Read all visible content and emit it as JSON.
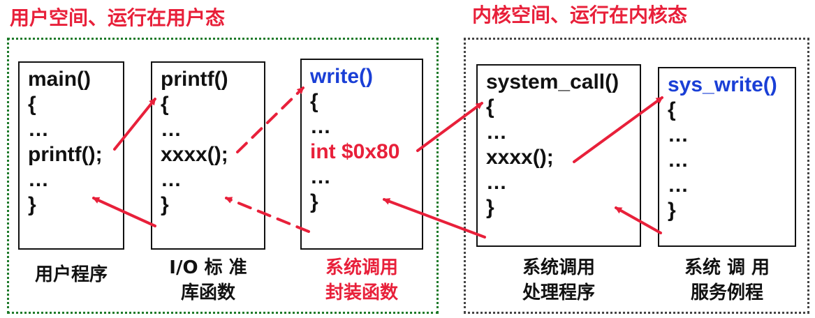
{
  "titles": {
    "user_space": "用户空间、运行在用户态",
    "kernel_space": "内核空间、运行在内核态"
  },
  "colors": {
    "title_red": "#e8203a",
    "code_blue": "#1a3fd6",
    "user_border_green": "#1e7a2a",
    "kernel_border": "#444444",
    "text": "#111111"
  },
  "boxes": {
    "main": {
      "lines": [
        "main()",
        "{",
        "…",
        "printf();",
        "…",
        "}"
      ],
      "label": [
        "用户程序"
      ]
    },
    "printf": {
      "lines": [
        "printf()",
        "{",
        "…",
        "xxxx();",
        "…",
        "}"
      ],
      "label": [
        "I/O 标 准",
        "库函数"
      ]
    },
    "write": {
      "lines": [
        "write()",
        "{",
        "…",
        "int $0x80",
        "…",
        "}"
      ],
      "label": [
        "系统调用",
        "封装函数"
      ]
    },
    "system_call": {
      "lines": [
        "system_call()",
        "{",
        "…",
        "xxxx();",
        "…",
        "}"
      ],
      "label": [
        "系统调用",
        "处理程序"
      ]
    },
    "sys_write": {
      "lines": [
        "sys_write()",
        "{",
        "…",
        "…",
        "…",
        "}"
      ],
      "label": [
        "系统 调 用",
        "服务例程"
      ]
    }
  }
}
